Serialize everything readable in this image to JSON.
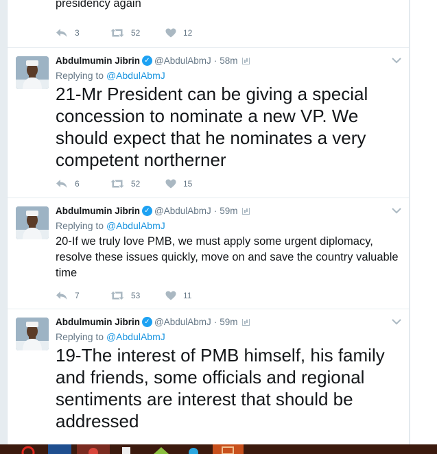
{
  "colors": {
    "link": "#1b95e0",
    "verified": "#1da1f2",
    "muted": "#657786",
    "icon": "#aab8c2",
    "taskbar": "#3c1a0e"
  },
  "tweets": [
    {
      "text": "presidency again",
      "replies": "3",
      "retweets": "52",
      "likes": "12"
    },
    {
      "name": "Abdulmumin Jibrin",
      "handle": "@AbdulAbmJ",
      "dot": "·",
      "time": "58m",
      "replying_prefix": "Replying to ",
      "replying_to": "@AbdulAbmJ",
      "text": "21-Mr President can be giving a special concession to nominate a new VP. We should expect that he nominates a very competent northerner",
      "replies": "6",
      "retweets": "52",
      "likes": "15"
    },
    {
      "name": "Abdulmumin Jibrin",
      "handle": "@AbdulAbmJ",
      "dot": "·",
      "time": "59m",
      "replying_prefix": "Replying to ",
      "replying_to": "@AbdulAbmJ",
      "text": "20-If we truly love PMB, we must apply some urgent diplomacy, resolve these issues quickly, move on and save the country valuable time",
      "replies": "7",
      "retweets": "53",
      "likes": "11"
    },
    {
      "name": "Abdulmumin Jibrin",
      "handle": "@AbdulAbmJ",
      "dot": "·",
      "time": "59m",
      "replying_prefix": "Replying to ",
      "replying_to": "@AbdulAbmJ",
      "text": "19-The interest of PMB himself, his family and friends, some officials and regional sentiments are interest that should be addressed"
    }
  ],
  "icons": {
    "reply": "reply-icon",
    "retweet": "retweet-icon",
    "like": "heart-icon",
    "verified": "verified-badge-icon",
    "caret": "chevron-down-icon",
    "analytics": "analytics-icon"
  }
}
